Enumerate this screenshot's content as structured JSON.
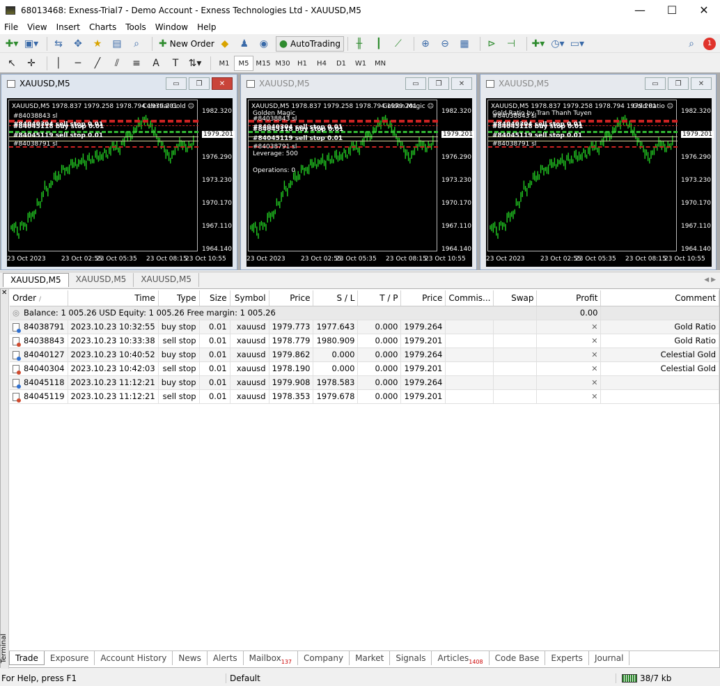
{
  "window": {
    "title": "68013468: Exness-Trial7 - Demo Account - Exness Technologies Ltd - XAUUSD,M5",
    "minimize": "—",
    "maximize": "☐",
    "close": "✕"
  },
  "menu": [
    "File",
    "View",
    "Insert",
    "Charts",
    "Tools",
    "Window",
    "Help"
  ],
  "toolbar": {
    "new_order": "New Order",
    "autotrading": "AutoTrading",
    "alert_count": "1"
  },
  "timeframes": [
    "M1",
    "M5",
    "M15",
    "M30",
    "H1",
    "H4",
    "D1",
    "W1",
    "MN"
  ],
  "selected_timeframe": "M5",
  "charts": [
    {
      "title": "XAUUSD,M5",
      "header": "XAUUSD,M5  1978.837 1979.258 1978.794 1979.201",
      "ea_name": "Celestial Gold",
      "lines": [
        "#84038843 sl",
        "#84040304 sell stop 0.01",
        "#84045118 buy stop 0.01",
        "#84045119 sell stop 0.01",
        "#84038791 sl"
      ],
      "info": []
    },
    {
      "title": "XAUUSD,M5",
      "header": "XAUUSD,M5  1978.837 1979.258 1978.794 1979.201",
      "ea_name": "Golden Magic",
      "lines": [
        "#84038843 sl",
        "#84040304 sell stop 0.01",
        "#84045118 buy stop 0.01",
        "#84045119 sell stop 0.01",
        "#84038791 sl"
      ],
      "info": [
        "Golden Magic",
        "Leverage: 500",
        "Operations: 0"
      ]
    },
    {
      "title": "XAUUSD,M5",
      "header": "XAUUSD,M5  1978.837 1979.258 1978.794 1979.201",
      "ea_name": "Gold Ratio",
      "lines": [
        "#84038843 sl",
        "#84040304 sell stop 0.01",
        "#84045118 buy stop 0.01",
        "#84045119 sell stop 0.01",
        "#84038791 sl"
      ],
      "info": [
        "Gold Ratio   by Tran Thanh Tuyen"
      ]
    }
  ],
  "price_axis": [
    "1982.320",
    "1979.201",
    "1976.290",
    "1973.230",
    "1970.170",
    "1967.110",
    "1964.140"
  ],
  "current_price": "1979.201",
  "time_axis": [
    "23 Oct 2023",
    "23 Oct 02:55",
    "23 Oct 05:35",
    "23 Oct 08:15",
    "23 Oct 10:55"
  ],
  "chart_tabs": [
    "XAUUSD,M5",
    "XAUUSD,M5",
    "XAUUSD,M5"
  ],
  "terminal": {
    "label": "Terminal",
    "columns": [
      "Order",
      "Time",
      "Type",
      "Size",
      "Symbol",
      "Price",
      "S / L",
      "T / P",
      "Price",
      "Commis...",
      "Swap",
      "Profit",
      "Comment"
    ],
    "sort_marker": "/",
    "balance_line": "Balance: 1 005.26 USD  Equity: 1 005.26  Free margin: 1 005.26",
    "balance_profit": "0.00",
    "orders": [
      {
        "order": "84038791",
        "time": "2023.10.23 10:32:55",
        "type": "buy stop",
        "size": "0.01",
        "symbol": "xauusd",
        "price": "1979.773",
        "sl": "1977.643",
        "tp": "0.000",
        "cur": "1979.264",
        "comment": "Gold Ratio"
      },
      {
        "order": "84038843",
        "time": "2023.10.23 10:33:38",
        "type": "sell stop",
        "size": "0.01",
        "symbol": "xauusd",
        "price": "1978.779",
        "sl": "1980.909",
        "tp": "0.000",
        "cur": "1979.201",
        "comment": "Gold Ratio"
      },
      {
        "order": "84040127",
        "time": "2023.10.23 10:40:52",
        "type": "buy stop",
        "size": "0.01",
        "symbol": "xauusd",
        "price": "1979.862",
        "sl": "0.000",
        "tp": "0.000",
        "cur": "1979.264",
        "comment": "Celestial Gold"
      },
      {
        "order": "84040304",
        "time": "2023.10.23 10:42:03",
        "type": "sell stop",
        "size": "0.01",
        "symbol": "xauusd",
        "price": "1978.190",
        "sl": "0.000",
        "tp": "0.000",
        "cur": "1979.201",
        "comment": "Celestial Gold"
      },
      {
        "order": "84045118",
        "time": "2023.10.23 11:12:21",
        "type": "buy stop",
        "size": "0.01",
        "symbol": "xauusd",
        "price": "1979.908",
        "sl": "1978.583",
        "tp": "0.000",
        "cur": "1979.264",
        "comment": ""
      },
      {
        "order": "84045119",
        "time": "2023.10.23 11:12:21",
        "type": "sell stop",
        "size": "0.01",
        "symbol": "xauusd",
        "price": "1978.353",
        "sl": "1979.678",
        "tp": "0.000",
        "cur": "1979.201",
        "comment": ""
      }
    ],
    "tabs": [
      {
        "label": "Trade",
        "badge": ""
      },
      {
        "label": "Exposure",
        "badge": ""
      },
      {
        "label": "Account History",
        "badge": ""
      },
      {
        "label": "News",
        "badge": ""
      },
      {
        "label": "Alerts",
        "badge": ""
      },
      {
        "label": "Mailbox",
        "badge": "137"
      },
      {
        "label": "Company",
        "badge": ""
      },
      {
        "label": "Market",
        "badge": ""
      },
      {
        "label": "Signals",
        "badge": ""
      },
      {
        "label": "Articles",
        "badge": "1408"
      },
      {
        "label": "Code Base",
        "badge": ""
      },
      {
        "label": "Experts",
        "badge": ""
      },
      {
        "label": "Journal",
        "badge": ""
      }
    ]
  },
  "status": {
    "help": "For Help, press F1",
    "profile": "Default",
    "traffic": "38/7 kb"
  },
  "colors": {
    "candle": "#22cc22",
    "sl_line": "#cc2222",
    "order_line": "#33bb33",
    "chart_bg": "#000000"
  }
}
